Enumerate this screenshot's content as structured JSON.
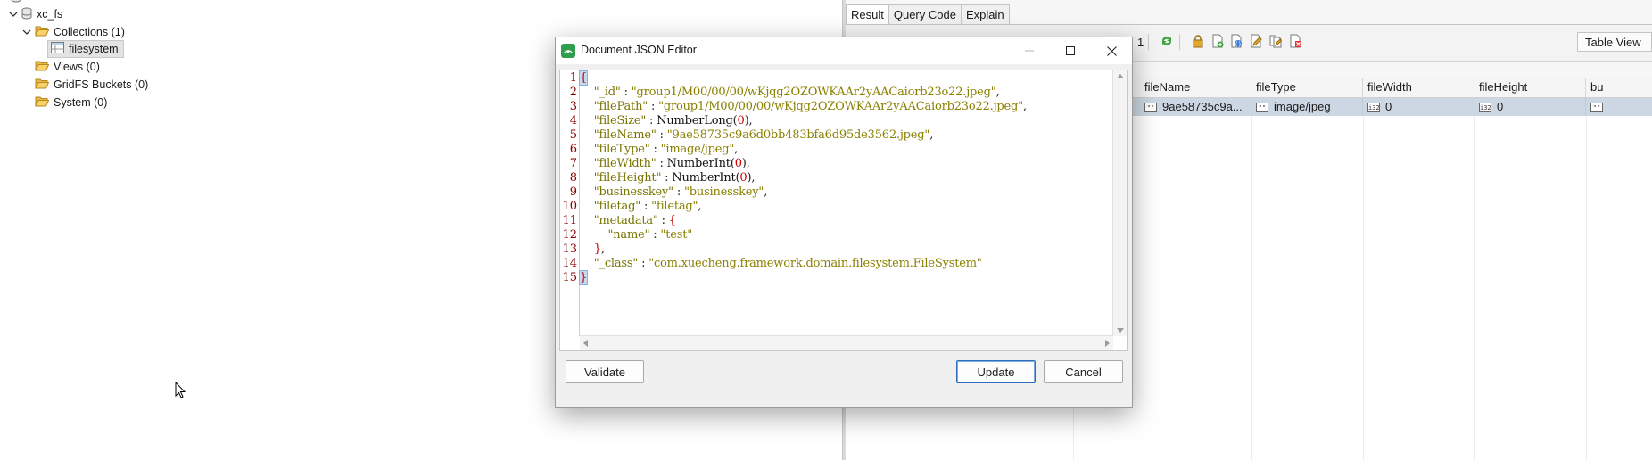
{
  "tree": {
    "db": "xc_fs",
    "collections": "Collections (1)",
    "collection_item": "filesystem",
    "views": "Views (0)",
    "gridfs": "GridFS Buckets (0)",
    "system": "System (0)"
  },
  "right": {
    "tabs": [
      "Result",
      "Query Code",
      "Explain"
    ],
    "page_number": "1",
    "view_mode": "Table View",
    "columns": [
      "fileName",
      "fileType",
      "fileWidth",
      "fileHeight",
      "bu"
    ],
    "row": {
      "fileName": "9ae58735c9a...",
      "fileType": "image/jpeg",
      "fileWidth": "0",
      "fileHeight": "0"
    }
  },
  "dialog": {
    "title": "Document JSON Editor",
    "buttons": {
      "validate": "Validate",
      "update": "Update",
      "cancel": "Cancel"
    },
    "lines": [
      {
        "n": "1",
        "parts": [
          {
            "c": "br bsel",
            "t": "{"
          }
        ]
      },
      {
        "n": "2",
        "parts": [
          {
            "c": "p",
            "t": "    "
          },
          {
            "c": "k",
            "t": "\"_id\""
          },
          {
            "c": "p",
            "t": " : "
          },
          {
            "c": "s",
            "t": "\"group1/M00/00/00/wKjqg2OZOWKAAr2yAACaiorb23o22.jpeg\""
          },
          {
            "c": "p",
            "t": ","
          }
        ]
      },
      {
        "n": "3",
        "parts": [
          {
            "c": "p",
            "t": "    "
          },
          {
            "c": "k",
            "t": "\"filePath\""
          },
          {
            "c": "p",
            "t": " : "
          },
          {
            "c": "s",
            "t": "\"group1/M00/00/00/wKjqg2OZOWKAAr2yAACaiorb23o22.jpeg\""
          },
          {
            "c": "p",
            "t": ","
          }
        ]
      },
      {
        "n": "4",
        "parts": [
          {
            "c": "p",
            "t": "    "
          },
          {
            "c": "k",
            "t": "\"fileSize\""
          },
          {
            "c": "p",
            "t": " : "
          },
          {
            "c": "f",
            "t": "NumberLong"
          },
          {
            "c": "p",
            "t": "("
          },
          {
            "c": "n",
            "t": "0"
          },
          {
            "c": "p",
            "t": "),"
          }
        ]
      },
      {
        "n": "5",
        "parts": [
          {
            "c": "p",
            "t": "    "
          },
          {
            "c": "k",
            "t": "\"fileName\""
          },
          {
            "c": "p",
            "t": " : "
          },
          {
            "c": "s",
            "t": "\"9ae58735c9a6d0bb483bfa6d95de3562.jpeg\""
          },
          {
            "c": "p",
            "t": ","
          }
        ]
      },
      {
        "n": "6",
        "parts": [
          {
            "c": "p",
            "t": "    "
          },
          {
            "c": "k",
            "t": "\"fileType\""
          },
          {
            "c": "p",
            "t": " : "
          },
          {
            "c": "s",
            "t": "\"image/jpeg\""
          },
          {
            "c": "p",
            "t": ","
          }
        ]
      },
      {
        "n": "7",
        "parts": [
          {
            "c": "p",
            "t": "    "
          },
          {
            "c": "k",
            "t": "\"fileWidth\""
          },
          {
            "c": "p",
            "t": " : "
          },
          {
            "c": "f",
            "t": "NumberInt"
          },
          {
            "c": "p",
            "t": "("
          },
          {
            "c": "n",
            "t": "0"
          },
          {
            "c": "p",
            "t": "),"
          }
        ]
      },
      {
        "n": "8",
        "parts": [
          {
            "c": "p",
            "t": "    "
          },
          {
            "c": "k",
            "t": "\"fileHeight\""
          },
          {
            "c": "p",
            "t": " : "
          },
          {
            "c": "f",
            "t": "NumberInt"
          },
          {
            "c": "p",
            "t": "("
          },
          {
            "c": "n",
            "t": "0"
          },
          {
            "c": "p",
            "t": "),"
          }
        ]
      },
      {
        "n": "9",
        "parts": [
          {
            "c": "p",
            "t": "    "
          },
          {
            "c": "k",
            "t": "\"businesskey\""
          },
          {
            "c": "p",
            "t": " : "
          },
          {
            "c": "s",
            "t": "\"businesskey\""
          },
          {
            "c": "p",
            "t": ","
          }
        ]
      },
      {
        "n": "10",
        "parts": [
          {
            "c": "p",
            "t": "    "
          },
          {
            "c": "k",
            "t": "\"filetag\""
          },
          {
            "c": "p",
            "t": " : "
          },
          {
            "c": "s",
            "t": "\"filetag\""
          },
          {
            "c": "p",
            "t": ","
          }
        ]
      },
      {
        "n": "11",
        "parts": [
          {
            "c": "p",
            "t": "    "
          },
          {
            "c": "k",
            "t": "\"metadata\""
          },
          {
            "c": "p",
            "t": " : "
          },
          {
            "c": "br",
            "t": "{"
          }
        ]
      },
      {
        "n": "12",
        "parts": [
          {
            "c": "p",
            "t": "        "
          },
          {
            "c": "k",
            "t": "\"name\""
          },
          {
            "c": "p",
            "t": " : "
          },
          {
            "c": "s",
            "t": "\"test\""
          }
        ]
      },
      {
        "n": "13",
        "parts": [
          {
            "c": "p",
            "t": "    "
          },
          {
            "c": "br",
            "t": "}"
          },
          {
            "c": "p",
            "t": ","
          }
        ]
      },
      {
        "n": "14",
        "parts": [
          {
            "c": "p",
            "t": "    "
          },
          {
            "c": "k",
            "t": "\"_class\""
          },
          {
            "c": "p",
            "t": " : "
          },
          {
            "c": "s",
            "t": "\"com.xuecheng.framework.domain.filesystem.FileSystem\""
          }
        ]
      },
      {
        "n": "15",
        "parts": [
          {
            "c": "br bsel",
            "t": "}"
          }
        ]
      }
    ]
  },
  "colors": {
    "accent": "#2f6fbd",
    "selection_row": "#cdd7e3",
    "key_text": "#7a7400",
    "line_numbers": "#8b0000"
  }
}
